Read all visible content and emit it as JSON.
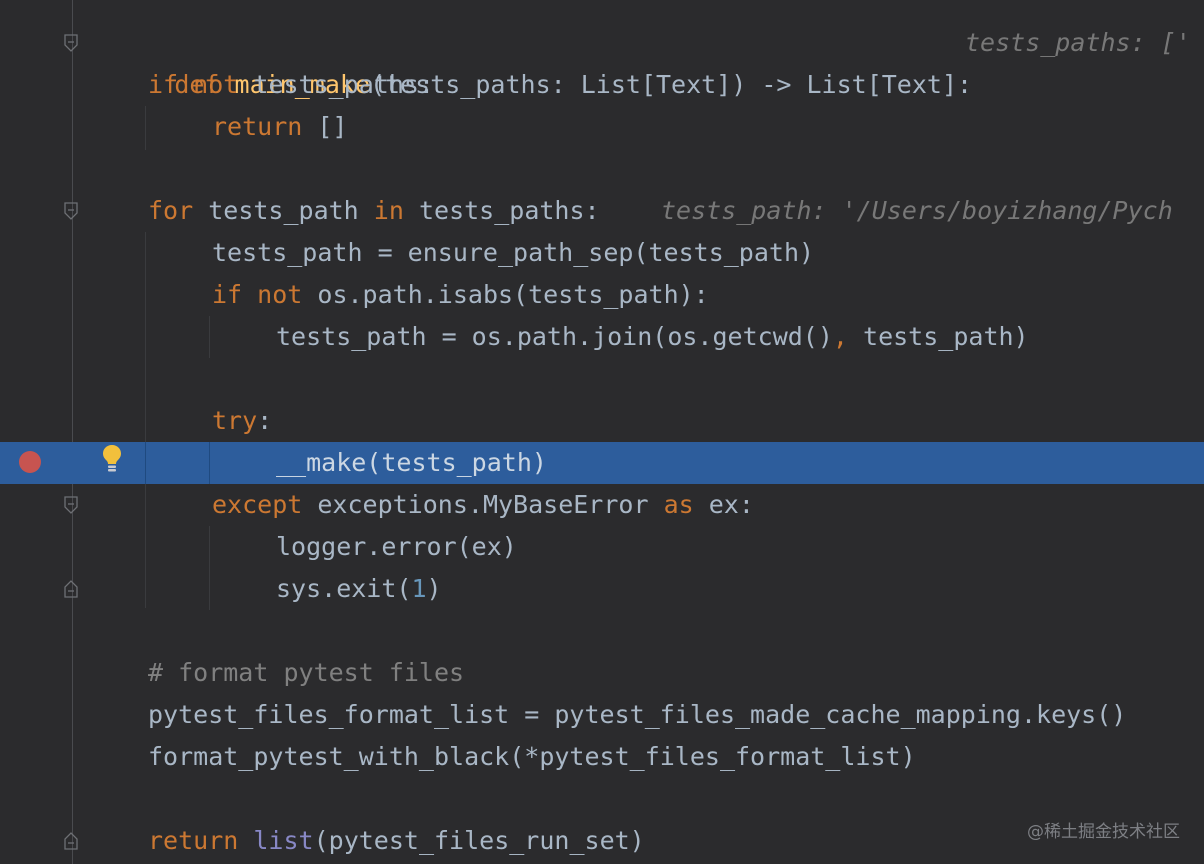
{
  "editor": {
    "theme": "darcula",
    "colors": {
      "background": "#2b2b2d",
      "current_line": "#2d5d9c",
      "keyword": "#cc7832",
      "function": "#ffc66d",
      "builtin": "#8888c6",
      "number": "#6897bb",
      "comment": "#808080",
      "breakpoint": "#c75450"
    },
    "watermark": "@稀土掘金技术社区",
    "lines": {
      "l1": {
        "kw_def": "def",
        "fn_name": "main_make",
        "signature": "(tests_paths: List[Text]) -> List[Text]:",
        "hint": "tests_paths: ['"
      },
      "l2": {
        "kw_if": "if",
        "kw_not": "not",
        "rest": "tests_paths:"
      },
      "l3": {
        "kw_return": "return",
        "rest": "[]"
      },
      "l5": {
        "kw_for": "for",
        "var": "tests_path",
        "kw_in": "in",
        "rest": "tests_paths:",
        "hint": "tests_path: '/Users/boyizhang/Pych"
      },
      "l6": {
        "text": "tests_path = ensure_path_sep(tests_path)"
      },
      "l7": {
        "kw_if": "if",
        "kw_not": "not",
        "rest": "os.path.isabs(tests_path):"
      },
      "l8": {
        "before": "tests_path = os.path.join(os.getcwd()",
        "comma": ",",
        "after": "tests_path)"
      },
      "l10": {
        "kw_try": "try",
        "colon": ":"
      },
      "l11": {
        "text": "__make(tests_path)"
      },
      "l12": {
        "kw_except": "except",
        "mid": "exceptions.MyBaseError",
        "kw_as": "as",
        "rest": "ex:"
      },
      "l13": {
        "text": "logger.error(ex)"
      },
      "l14": {
        "before": "sys.exit(",
        "num": "1",
        "after": ")"
      },
      "l16": {
        "comment": "# format pytest files"
      },
      "l17": {
        "text": "pytest_files_format_list = pytest_files_made_cache_mapping.keys()"
      },
      "l18": {
        "text": "format_pytest_with_black(*pytest_files_format_list)"
      },
      "l20": {
        "kw_return": "return",
        "bi_list": "list",
        "rest": "(pytest_files_run_set)"
      }
    },
    "gutter": {
      "breakpoint_line": 11,
      "intention_icon": "lightbulb-icon",
      "fold_markers": [
        "fold-start",
        "fold-start",
        "fold-start",
        "fold-end",
        "fold-end"
      ]
    }
  }
}
